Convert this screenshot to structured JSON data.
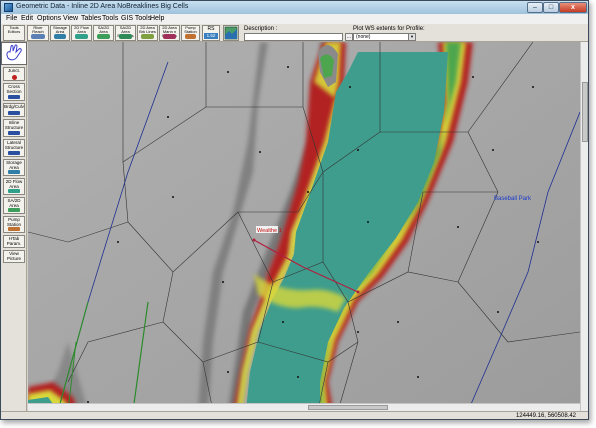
{
  "window": {
    "title": "Geometric Data - Inline 2D Area NoBreaklines Big Cells",
    "controls": {
      "minimize": "–",
      "maximize": "□",
      "close": "x"
    }
  },
  "menu": [
    "File",
    "Edit",
    "Options",
    "View",
    "Tables",
    "Tools",
    "GIS Tools",
    "Help"
  ],
  "toolbar": {
    "tools_editors": "Tools\nEditors",
    "buttons": [
      {
        "label": "River\nReach",
        "color": "#5a7fb5"
      },
      {
        "label": "Storage\nArea",
        "color": "#2f7fa8"
      },
      {
        "label": "2D Flow\nArea",
        "color": "#2fa08a"
      },
      {
        "label": "SA/2D Area\nConn",
        "color": "#3c9e5a"
      },
      {
        "label": "SA/2D Area\nBC Lines",
        "color": "#2e8b57"
      },
      {
        "label": "2D Area\nBrk Lines",
        "color": "#7fa040"
      },
      {
        "label": "2D Area\nMann n Regions",
        "color": "#a0305a"
      },
      {
        "label": "Pump\nStation",
        "color": "#c07030"
      }
    ],
    "rs_label": "RS",
    "rs_value": "1.52",
    "description_label": "Description :",
    "description_value": "",
    "description_btn": "...",
    "plot_ws_label": "Plot WS extents for Profile:",
    "plot_ws_value": "(none)"
  },
  "leftbar": [
    {
      "label": "Junct.",
      "color": "#c02020"
    },
    {
      "label": "Cross\nSection",
      "color": "#2a4fa0"
    },
    {
      "label": "Brdg/Culv",
      "color": "#2a4fa0"
    },
    {
      "label": "Inline\nStructure",
      "color": "#2a4fa0"
    },
    {
      "label": "Lateral\nStructure",
      "color": "#2a4fa0"
    },
    {
      "label": "Storage\nArea",
      "color": "#2f7fa8"
    },
    {
      "label": "2D Flow\nArea",
      "color": "#2fa08a"
    },
    {
      "label": "SA/2D Area\nConn",
      "color": "#3c9e5a"
    },
    {
      "label": "Pump\nStation",
      "color": "#c07030"
    },
    {
      "label": "HTab\nParam.",
      "color": "#7a7a7a"
    },
    {
      "label": "View\nPicture",
      "color": "#7a7a7a"
    }
  ],
  "map": {
    "labels": {
      "inline_structure": "Wealthe 1",
      "place": "Baseball Park"
    },
    "colors": {
      "terrain": "#a6a6a6",
      "water_teal": "#3f9d8d",
      "water_green": "#4da64d",
      "water_yellow": "#d8d83a",
      "water_red": "#b22222",
      "cell_lines": "#333333",
      "reach_line": "#1f2f8f",
      "breakline_green": "#2e8b2e"
    }
  },
  "status": {
    "coordinates": "124449.16, 560508.42"
  }
}
